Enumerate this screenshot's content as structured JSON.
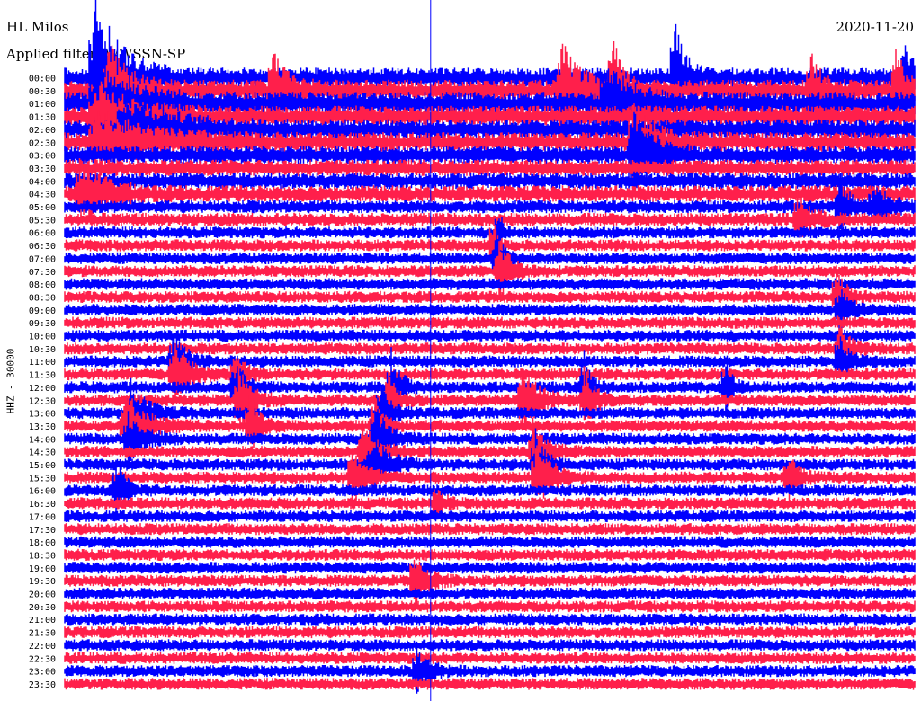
{
  "header": {
    "station": "HL Milos",
    "filter": "Applied filter: WWSSN-SP",
    "date": "2020-11-20"
  },
  "chart_data": {
    "type": "line",
    "title": "HL Milos",
    "subtitle": "Applied filter: WWSSN-SP",
    "date": "2020-11-20",
    "ylabel": "HHZ - 30000",
    "xlabel": "",
    "row_labels": [
      "00:00",
      "00:30",
      "01:00",
      "01:30",
      "02:00",
      "02:30",
      "03:00",
      "03:30",
      "04:00",
      "04:30",
      "05:00",
      "05:30",
      "06:00",
      "06:30",
      "07:00",
      "07:30",
      "08:00",
      "08:30",
      "09:00",
      "09:30",
      "10:00",
      "10:30",
      "11:00",
      "11:30",
      "12:00",
      "12:30",
      "13:00",
      "13:30",
      "14:00",
      "14:30",
      "15:00",
      "15:30",
      "16:00",
      "16:30",
      "17:00",
      "17:30",
      "18:00",
      "18:30",
      "19:00",
      "19:30",
      "20:00",
      "20:30",
      "21:00",
      "21:30",
      "22:00",
      "22:30",
      "23:00",
      "23:30"
    ],
    "row_interval_minutes": 30,
    "series_colors": [
      "#0000ff",
      "#ff1f4b"
    ],
    "marker_color": "#0000ff",
    "marker_minute": 12.9,
    "rows": [
      {
        "time": "00:00",
        "level": 1.3,
        "events": [
          {
            "minute": 1,
            "amp": 3.5,
            "width": 0.8
          },
          {
            "minute": 21.5,
            "amp": 2.5,
            "width": 0.3
          },
          {
            "minute": 29.6,
            "amp": 2.2,
            "width": 0.2
          }
        ]
      },
      {
        "time": "00:30",
        "level": 1.4,
        "events": [
          {
            "minute": 1.5,
            "amp": 1.8,
            "width": 0.6
          },
          {
            "minute": 7.3,
            "amp": 1.6,
            "width": 0.4
          },
          {
            "minute": 17.5,
            "amp": 1.7,
            "width": 0.6
          },
          {
            "minute": 19.3,
            "amp": 2,
            "width": 0.3
          },
          {
            "minute": 26.3,
            "amp": 1.4,
            "width": 0.3
          },
          {
            "minute": 29.3,
            "amp": 1.6,
            "width": 0.3
          }
        ]
      },
      {
        "time": "01:00",
        "level": 1.5,
        "events": [
          {
            "minute": 1,
            "amp": 1.5,
            "width": 1.2
          },
          {
            "minute": 19,
            "amp": 1.5,
            "width": 0.8
          }
        ]
      },
      {
        "time": "01:30",
        "level": 1.4,
        "events": [
          {
            "minute": 1,
            "amp": 1.3,
            "width": 1
          }
        ]
      },
      {
        "time": "02:00",
        "level": 1.3,
        "events": [
          {
            "minute": 2,
            "amp": 1.2,
            "width": 1.5
          }
        ]
      },
      {
        "time": "02:30",
        "level": 1.3,
        "events": [
          {
            "minute": 1,
            "amp": 1.2,
            "width": 1.5
          },
          {
            "minute": 20,
            "amp": 1.4,
            "width": 0.7
          }
        ]
      },
      {
        "time": "03:00",
        "level": 1.2,
        "events": [
          {
            "minute": 20,
            "amp": 2,
            "width": 0.6
          }
        ]
      },
      {
        "time": "03:30",
        "level": 1.1,
        "events": []
      },
      {
        "time": "04:00",
        "level": 1.1,
        "events": []
      },
      {
        "time": "04:30",
        "level": 1.1,
        "events": [
          {
            "minute": 0.5,
            "amp": 1.3,
            "width": 0.8
          }
        ]
      },
      {
        "time": "05:00",
        "level": 0.9,
        "events": [
          {
            "minute": 27.3,
            "amp": 1.3,
            "width": 0.3
          },
          {
            "minute": 28.5,
            "amp": 0.8,
            "width": 0.5
          }
        ]
      },
      {
        "time": "05:30",
        "level": 0.9,
        "events": [
          {
            "minute": 25.8,
            "amp": 1,
            "width": 0.4
          }
        ]
      },
      {
        "time": "06:00",
        "level": 0.8,
        "events": [
          {
            "minute": 15.3,
            "amp": 1.1,
            "width": 0.1
          }
        ]
      },
      {
        "time": "06:30",
        "level": 0.8,
        "events": [
          {
            "minute": 15.1,
            "amp": 1.2,
            "width": 0.1
          }
        ]
      },
      {
        "time": "07:00",
        "level": 0.8,
        "events": [
          {
            "minute": 15.2,
            "amp": 1.2,
            "width": 0.2
          }
        ]
      },
      {
        "time": "07:30",
        "level": 0.8,
        "events": [
          {
            "minute": 15.3,
            "amp": 1.2,
            "width": 0.4
          }
        ]
      },
      {
        "time": "08:00",
        "level": 0.8,
        "events": []
      },
      {
        "time": "08:30",
        "level": 0.8,
        "events": [
          {
            "minute": 27.2,
            "amp": 1.1,
            "width": 0.3
          }
        ]
      },
      {
        "time": "09:00",
        "level": 0.8,
        "events": [
          {
            "minute": 27.3,
            "amp": 1,
            "width": 0.3
          }
        ]
      },
      {
        "time": "09:30",
        "level": 0.8,
        "events": []
      },
      {
        "time": "10:00",
        "level": 0.8,
        "events": []
      },
      {
        "time": "10:30",
        "level": 0.8,
        "events": [
          {
            "minute": 27.3,
            "amp": 1,
            "width": 0.3
          }
        ]
      },
      {
        "time": "11:00",
        "level": 0.8,
        "events": [
          {
            "minute": 3.8,
            "amp": 1.2,
            "width": 0.4
          },
          {
            "minute": 27.3,
            "amp": 1.1,
            "width": 0.3
          }
        ]
      },
      {
        "time": "11:30",
        "level": 0.8,
        "events": [
          {
            "minute": 3.8,
            "amp": 1.3,
            "width": 0.5
          },
          {
            "minute": 6,
            "amp": 0.9,
            "width": 0.3
          }
        ]
      },
      {
        "time": "12:00",
        "level": 0.8,
        "events": [
          {
            "minute": 6,
            "amp": 1.2,
            "width": 0.3
          },
          {
            "minute": 11.5,
            "amp": 1.4,
            "width": 0.3
          },
          {
            "minute": 18.3,
            "amp": 1.4,
            "width": 0.2
          },
          {
            "minute": 23.3,
            "amp": 1,
            "width": 0.2
          }
        ]
      },
      {
        "time": "12:30",
        "level": 0.8,
        "events": [
          {
            "minute": 6.1,
            "amp": 1.4,
            "width": 0.4
          },
          {
            "minute": 11.3,
            "amp": 1.4,
            "width": 0.3
          },
          {
            "minute": 16.1,
            "amp": 1.5,
            "width": 0.5
          },
          {
            "minute": 18.3,
            "amp": 1.3,
            "width": 0.3
          }
        ]
      },
      {
        "time": "13:00",
        "level": 0.8,
        "events": [
          {
            "minute": 2.3,
            "amp": 1.2,
            "width": 0.5
          },
          {
            "minute": 11.1,
            "amp": 1.3,
            "width": 0.3
          }
        ]
      },
      {
        "time": "13:30",
        "level": 0.8,
        "events": [
          {
            "minute": 2.1,
            "amp": 1.4,
            "width": 0.6
          },
          {
            "minute": 6.5,
            "amp": 1.3,
            "width": 0.3
          },
          {
            "minute": 10.9,
            "amp": 1.3,
            "width": 0.3
          }
        ]
      },
      {
        "time": "14:00",
        "level": 0.8,
        "events": [
          {
            "minute": 2.2,
            "amp": 1,
            "width": 0.5
          },
          {
            "minute": 10.9,
            "amp": 1.4,
            "width": 0.4
          }
        ]
      },
      {
        "time": "14:30",
        "level": 0.8,
        "events": [
          {
            "minute": 10.5,
            "amp": 1.3,
            "width": 0.4
          },
          {
            "minute": 16.5,
            "amp": 1.2,
            "width": 0.4
          }
        ]
      },
      {
        "time": "15:00",
        "level": 0.8,
        "events": [
          {
            "minute": 10.8,
            "amp": 1.3,
            "width": 0.5
          },
          {
            "minute": 16.6,
            "amp": 1.2,
            "width": 0.3
          }
        ]
      },
      {
        "time": "15:30",
        "level": 0.8,
        "events": [
          {
            "minute": 10.1,
            "amp": 1.3,
            "width": 0.4
          },
          {
            "minute": 16.6,
            "amp": 1.4,
            "width": 0.5
          },
          {
            "minute": 25.5,
            "amp": 1,
            "width": 0.3
          }
        ]
      },
      {
        "time": "16:00",
        "level": 0.8,
        "events": [
          {
            "minute": 1.8,
            "amp": 1.2,
            "width": 0.3
          }
        ]
      },
      {
        "time": "16:30",
        "level": 0.8,
        "events": [
          {
            "minute": 13.1,
            "amp": 0.8,
            "width": 0.2
          }
        ]
      },
      {
        "time": "17:00",
        "level": 0.8,
        "events": []
      },
      {
        "time": "17:30",
        "level": 0.8,
        "events": []
      },
      {
        "time": "18:00",
        "level": 0.8,
        "events": []
      },
      {
        "time": "18:30",
        "level": 0.8,
        "events": []
      },
      {
        "time": "19:00",
        "level": 0.8,
        "events": []
      },
      {
        "time": "19:30",
        "level": 0.8,
        "events": [
          {
            "minute": 12.3,
            "amp": 1.1,
            "width": 0.4
          }
        ]
      },
      {
        "time": "20:00",
        "level": 0.8,
        "events": []
      },
      {
        "time": "20:30",
        "level": 0.8,
        "events": []
      },
      {
        "time": "21:00",
        "level": 0.8,
        "events": []
      },
      {
        "time": "21:30",
        "level": 0.8,
        "events": []
      },
      {
        "time": "22:00",
        "level": 0.8,
        "events": []
      },
      {
        "time": "22:30",
        "level": 0.8,
        "events": []
      },
      {
        "time": "23:00",
        "level": 0.8,
        "events": [
          {
            "minute": 12.4,
            "amp": 0.8,
            "width": 0.4
          }
        ]
      },
      {
        "time": "23:30",
        "level": 0.8,
        "events": []
      }
    ]
  }
}
